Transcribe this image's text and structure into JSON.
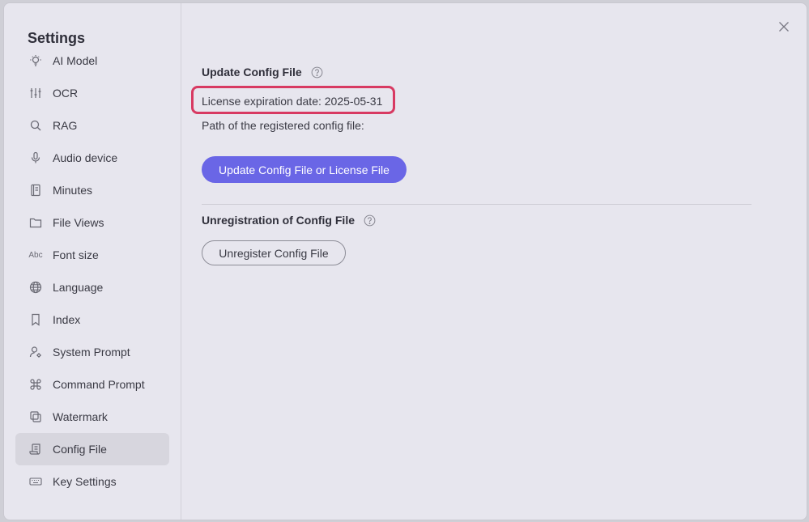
{
  "sidebar": {
    "title": "Settings",
    "items": [
      {
        "label": "AI Model",
        "icon": "lightbulb-icon"
      },
      {
        "label": "OCR",
        "icon": "sliders-icon"
      },
      {
        "label": "RAG",
        "icon": "search-icon"
      },
      {
        "label": "Audio device",
        "icon": "microphone-icon"
      },
      {
        "label": "Minutes",
        "icon": "notebook-icon"
      },
      {
        "label": "File Views",
        "icon": "folder-icon"
      },
      {
        "label": "Font size",
        "icon": "abc-icon",
        "icon_text": "Abc"
      },
      {
        "label": "Language",
        "icon": "globe-icon"
      },
      {
        "label": "Index",
        "icon": "bookmark-icon"
      },
      {
        "label": "System Prompt",
        "icon": "user-gear-icon"
      },
      {
        "label": "Command Prompt",
        "icon": "command-icon"
      },
      {
        "label": "Watermark",
        "icon": "copy-icon"
      },
      {
        "label": "Config File",
        "icon": "scroll-icon",
        "active": true
      },
      {
        "label": "Key Settings",
        "icon": "keyboard-icon"
      }
    ]
  },
  "main": {
    "update_section": {
      "title": "Update Config File",
      "license_text": "License expiration date: 2025-05-31",
      "path_text": "Path of the registered config file:",
      "button_label": "Update Config File or License File"
    },
    "unregister_section": {
      "title": "Unregistration of Config File",
      "button_label": "Unregister Config File"
    }
  },
  "colors": {
    "accent": "#6a66e6",
    "highlight": "#d83a62",
    "background": "#e7e6ee",
    "active_item": "#d7d6de"
  }
}
